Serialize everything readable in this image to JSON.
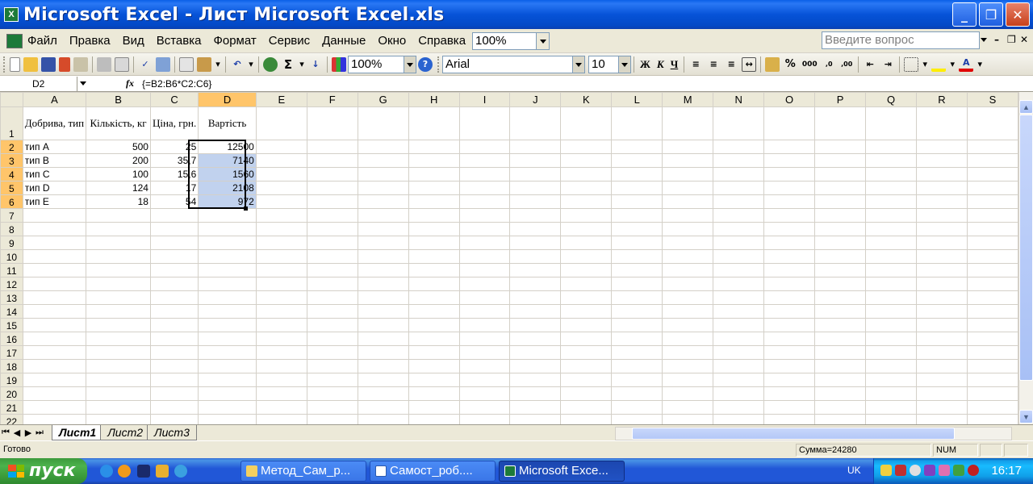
{
  "window": {
    "title": "Microsoft Excel - Лист Microsoft Excel.xls",
    "app_icon_label": "X"
  },
  "menu": {
    "items": [
      "Файл",
      "Правка",
      "Вид",
      "Вставка",
      "Формат",
      "Сервис",
      "Данные",
      "Окно",
      "Справка"
    ],
    "zoom": "100%",
    "help_placeholder": "Введите вопрос"
  },
  "toolbar": {
    "zoom": "100%",
    "font": "Arial",
    "size": "10",
    "bold": "Ж",
    "italic": "К",
    "underline": "Ч",
    "sigma": "Σ",
    "percent": "%",
    "thousands": "000"
  },
  "formula_bar": {
    "cell_ref": "D2",
    "fx": "fx",
    "formula": "{=B2:B6*C2:C6}"
  },
  "sheet": {
    "columns": [
      "A",
      "B",
      "C",
      "D",
      "E",
      "F",
      "G",
      "H",
      "I",
      "J",
      "K",
      "L",
      "M",
      "N",
      "O",
      "P",
      "Q",
      "R",
      "S"
    ],
    "selected_column": "D",
    "header_row": [
      "Добрива, тип",
      "Кількість, кг",
      "Ціна, грн.",
      "Вартість"
    ],
    "rows": [
      [
        "тип A",
        "500",
        "25",
        "12500"
      ],
      [
        "тип B",
        "200",
        "35,7",
        "7140"
      ],
      [
        "тип C",
        "100",
        "15,6",
        "1560"
      ],
      [
        "тип D",
        "124",
        "17",
        "2108"
      ],
      [
        "тип E",
        "18",
        "54",
        "972"
      ]
    ],
    "row_numbers": [
      "1",
      "2",
      "3",
      "4",
      "5",
      "6",
      "7",
      "8",
      "9",
      "10",
      "11",
      "12",
      "13",
      "14",
      "15",
      "16",
      "17",
      "18",
      "19",
      "20",
      "21",
      "22"
    ]
  },
  "tabs": [
    "Лист1",
    "Лист2",
    "Лист3"
  ],
  "status": {
    "ready": "Готово",
    "sum": "Сумма=24280",
    "num": "NUM"
  },
  "taskbar": {
    "start": "пуск",
    "buttons": [
      "Метод_Сам_р...",
      "Самост_роб....",
      "Microsoft Exce..."
    ],
    "lang": "UK",
    "clock": "16:17"
  }
}
